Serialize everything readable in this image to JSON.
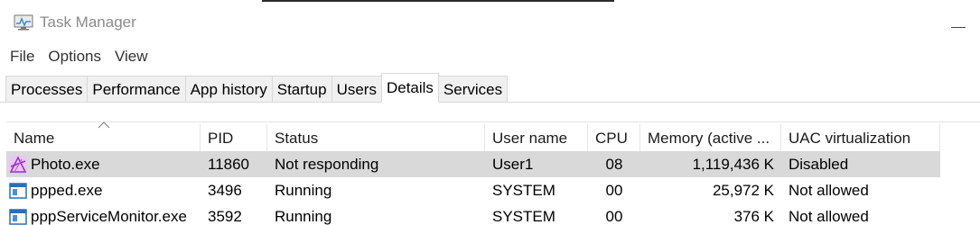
{
  "window": {
    "title": "Task Manager"
  },
  "menu": [
    "File",
    "Options",
    "View"
  ],
  "tabs": [
    "Processes",
    "Performance",
    "App history",
    "Startup",
    "Users",
    "Details",
    "Services"
  ],
  "active_tab": "Details",
  "table": {
    "columns": [
      "Name",
      "PID",
      "Status",
      "User name",
      "CPU",
      "Memory (active ...",
      "UAC virtualization"
    ],
    "sorted_column": "Name",
    "rows": [
      {
        "name": "Photo.exe",
        "pid": "11860",
        "status": "Not responding",
        "user": "User1",
        "cpu": "08",
        "memory": "1,119,436 K",
        "uac": "Disabled",
        "icon": "affinity-photo-icon",
        "selected": true
      },
      {
        "name": "ppped.exe",
        "pid": "3496",
        "status": "Running",
        "user": "SYSTEM",
        "cpu": "00",
        "memory": "25,972 K",
        "uac": "Not allowed",
        "icon": "process-window-icon",
        "selected": false
      },
      {
        "name": "pppServiceMonitor.exe",
        "pid": "3592",
        "status": "Running",
        "user": "SYSTEM",
        "cpu": "00",
        "memory": "376 K",
        "uac": "Not allowed",
        "icon": "process-window-icon",
        "selected": false
      }
    ]
  },
  "colors": {
    "selected_row": "#d9d9d9",
    "title_text": "#8a8a8a",
    "photo_icon": "#b44fd6"
  }
}
